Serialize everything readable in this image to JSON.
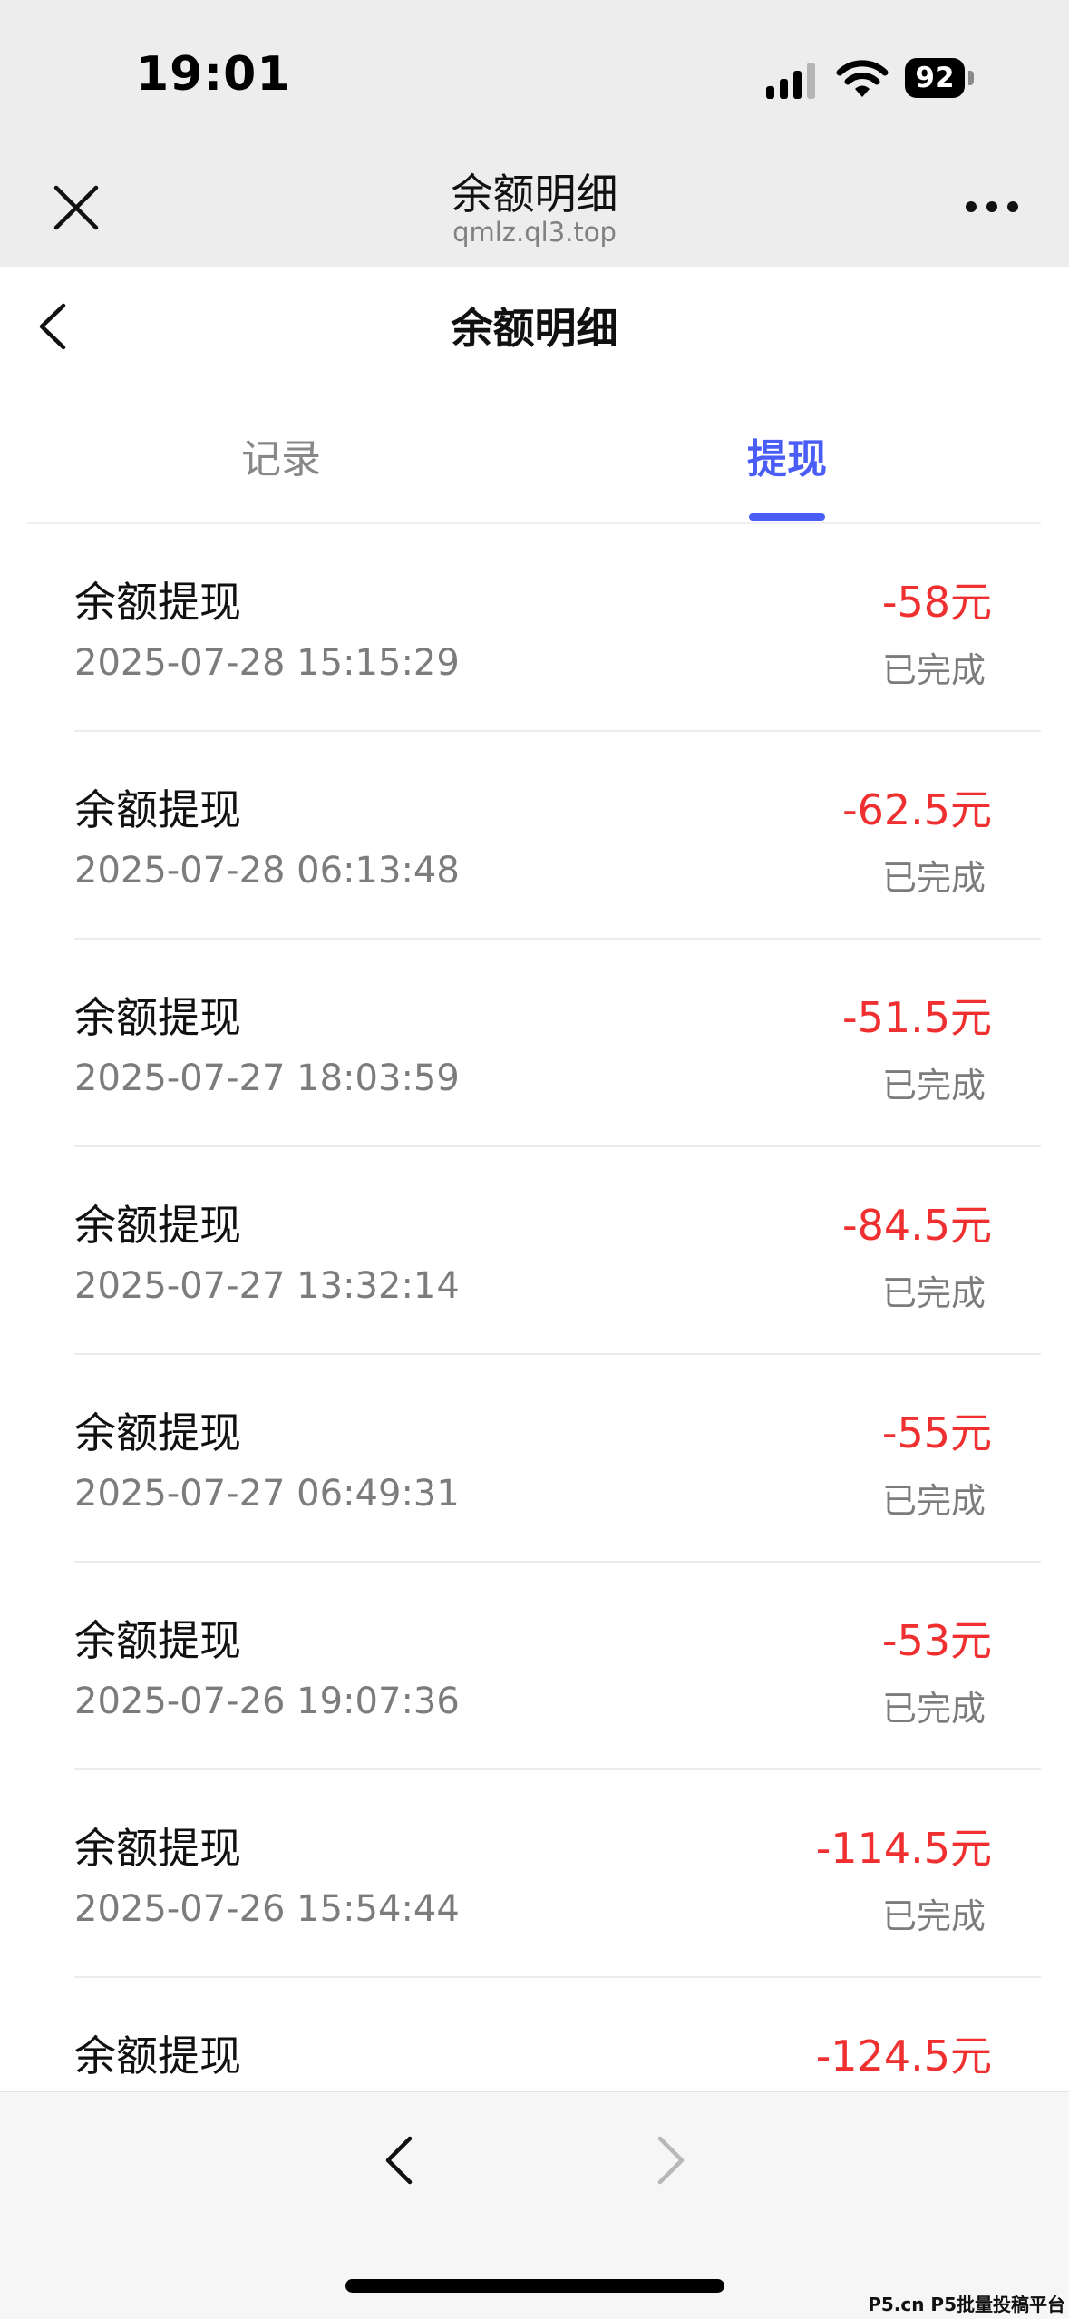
{
  "status_bar": {
    "time": "19:01",
    "battery_level": "92",
    "icons": [
      "signal-icon",
      "wifi-icon",
      "battery-icon"
    ]
  },
  "webview": {
    "title": "余额明细",
    "url": "qmlz.ql3.top",
    "icons": [
      "close-icon",
      "more-icon"
    ]
  },
  "page": {
    "title": "余额明细",
    "back_icon": "chevron-left-icon"
  },
  "tabs": [
    {
      "label": "记录",
      "active": false
    },
    {
      "label": "提现",
      "active": true
    }
  ],
  "transactions": [
    {
      "title": "余额提现",
      "datetime": "2025-07-28 15:15:29",
      "amount": "-58元",
      "status": "已完成"
    },
    {
      "title": "余额提现",
      "datetime": "2025-07-28 06:13:48",
      "amount": "-62.5元",
      "status": "已完成"
    },
    {
      "title": "余额提现",
      "datetime": "2025-07-27 18:03:59",
      "amount": "-51.5元",
      "status": "已完成"
    },
    {
      "title": "余额提现",
      "datetime": "2025-07-27 13:32:14",
      "amount": "-84.5元",
      "status": "已完成"
    },
    {
      "title": "余额提现",
      "datetime": "2025-07-27 06:49:31",
      "amount": "-55元",
      "status": "已完成"
    },
    {
      "title": "余额提现",
      "datetime": "2025-07-26 19:07:36",
      "amount": "-53元",
      "status": "已完成"
    },
    {
      "title": "余额提现",
      "datetime": "2025-07-26 15:54:44",
      "amount": "-114.5元",
      "status": "已完成"
    },
    {
      "title": "余额提现",
      "datetime": "",
      "amount": "-124.5元",
      "status": ""
    }
  ],
  "colors": {
    "accent": "#4a5ef7",
    "amount_negative": "#f03030",
    "header_bg": "#ededed"
  },
  "watermark": "P5.cn P5批量投稿平台"
}
